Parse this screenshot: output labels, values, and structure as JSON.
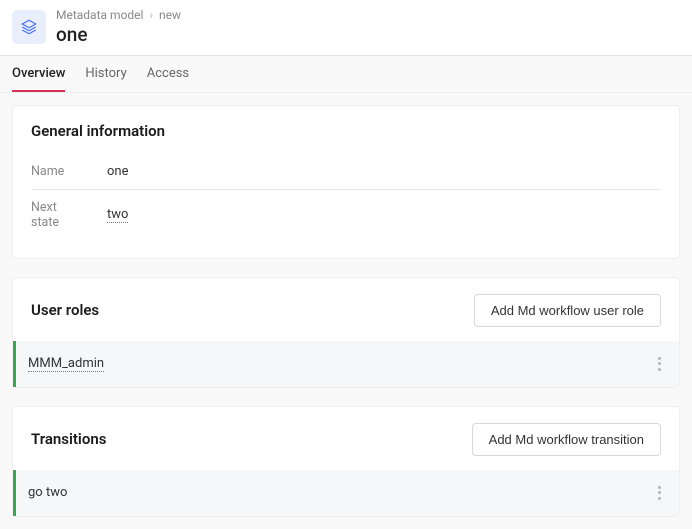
{
  "header": {
    "breadcrumb_parent": "Metadata model",
    "breadcrumb_current": "new",
    "title": "one"
  },
  "tabs": [
    {
      "label": "Overview",
      "active": true
    },
    {
      "label": "History",
      "active": false
    },
    {
      "label": "Access",
      "active": false
    }
  ],
  "general": {
    "section_title": "General information",
    "name_label": "Name",
    "name_value": "one",
    "next_state_label": "Next state",
    "next_state_value": "two"
  },
  "user_roles": {
    "section_title": "User roles",
    "add_button": "Add Md workflow user role",
    "items": [
      {
        "label": "MMM_admin"
      }
    ]
  },
  "transitions": {
    "section_title": "Transitions",
    "add_button": "Add Md workflow transition",
    "items": [
      {
        "label": "go two"
      }
    ]
  }
}
